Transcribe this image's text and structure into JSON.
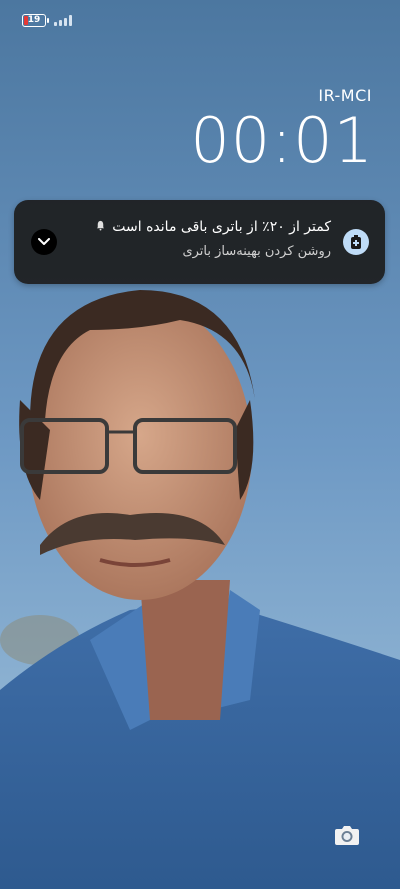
{
  "status_bar": {
    "battery_percent": "19",
    "battery_color": "#e53935",
    "signal_bars": 4
  },
  "lockscreen": {
    "carrier": "IR-MCI",
    "time": "00:01"
  },
  "notification": {
    "title": "کمتر از ۲۰٪ از باتری باقی مانده است",
    "subtitle": "روشن کردن بهینه‌ساز باتری",
    "icon": "battery-plus-icon",
    "bell_icon": "bell-muted-icon",
    "expand_icon": "chevron-down-icon"
  },
  "shortcuts": {
    "camera_icon": "camera-icon"
  }
}
